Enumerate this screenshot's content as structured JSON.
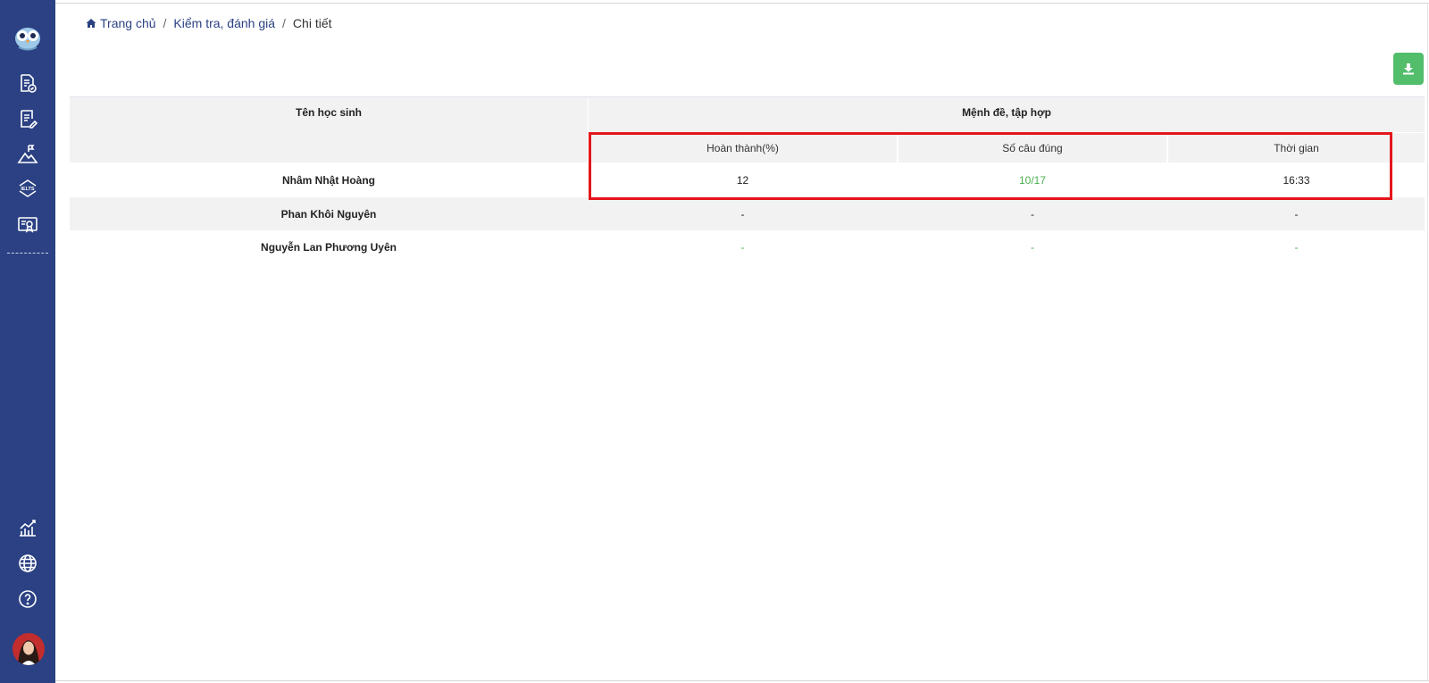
{
  "breadcrumb": {
    "home": "Trang chủ",
    "section": "Kiểm tra, đánh giá",
    "current": "Chi tiết",
    "separator": "/"
  },
  "sidebar": {
    "items": [
      {
        "icon": "document-check-icon"
      },
      {
        "icon": "document-edit-icon"
      },
      {
        "icon": "mountain-flag-icon"
      },
      {
        "icon": "ielts-icon"
      },
      {
        "icon": "certificate-icon"
      }
    ],
    "bottom_items": [
      {
        "icon": "chart-icon"
      },
      {
        "icon": "globe-icon"
      },
      {
        "icon": "help-icon"
      }
    ],
    "ielts_label": "IELTS"
  },
  "table": {
    "name_header": "Tên học sinh",
    "group_header": "Mệnh đề, tập hợp",
    "sub_headers": [
      "Hoàn thành(%)",
      "Số câu đúng",
      "Thời gian"
    ],
    "rows": [
      {
        "name": "Nhâm Nhật Hoàng",
        "completion": "12",
        "correct": "10/17",
        "time": "16:33"
      },
      {
        "name": "Phan Khôi Nguyên",
        "completion": "-",
        "correct": "-",
        "time": "-"
      },
      {
        "name": "Nguyễn Lan Phương Uyên",
        "completion": "-",
        "correct": "-",
        "time": "-"
      }
    ]
  },
  "colors": {
    "sidebar": "#2b4183",
    "download_button": "#52bd6b",
    "highlight_box": "#e3161b",
    "correct_text": "#4caf50"
  }
}
